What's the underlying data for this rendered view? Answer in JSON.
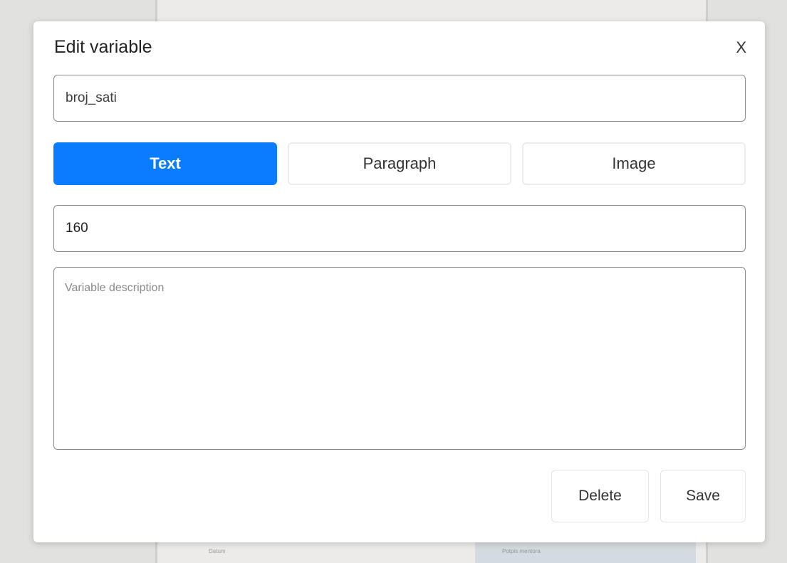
{
  "background": {
    "cell_left": "Datum",
    "cell_right": "Potpis mentora"
  },
  "dialog": {
    "title": "Edit variable",
    "close_label": "X",
    "name_value": "broj_sati",
    "type_options": [
      {
        "label": "Text",
        "selected": true
      },
      {
        "label": "Paragraph",
        "selected": false
      },
      {
        "label": "Image",
        "selected": false
      }
    ],
    "value": "160",
    "description_value": "",
    "description_placeholder": "Variable description",
    "delete_label": "Delete",
    "save_label": "Save"
  },
  "colors": {
    "accent": "#0a7cff",
    "overlay": "#e1e1e0"
  }
}
